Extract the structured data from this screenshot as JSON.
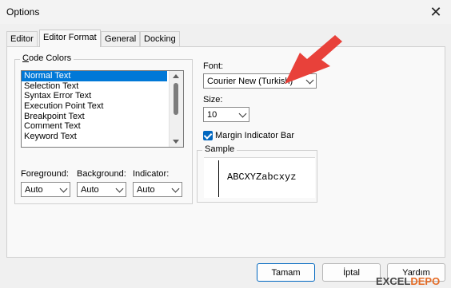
{
  "window": {
    "title": "Options",
    "close_glyph": "✕"
  },
  "tabs": [
    "Editor",
    "Editor Format",
    "General",
    "Docking"
  ],
  "active_tab": "Editor Format",
  "code_colors": {
    "label": "Code Colors",
    "items": [
      "Normal Text",
      "Selection Text",
      "Syntax Error Text",
      "Execution Point Text",
      "Breakpoint Text",
      "Comment Text",
      "Keyword Text"
    ],
    "selected": "Normal Text"
  },
  "color_selectors": [
    {
      "label": "Foreground:",
      "value": "Auto"
    },
    {
      "label": "Background:",
      "value": "Auto"
    },
    {
      "label": "Indicator:",
      "value": "Auto"
    }
  ],
  "font": {
    "label": "Font:",
    "value": "Courier New (Turkish)"
  },
  "size": {
    "label": "Size:",
    "value": "10"
  },
  "margin_indicator": {
    "label": "Margin Indicator Bar",
    "checked": true
  },
  "sample": {
    "label": "Sample",
    "text": "ABCXYZabcxyz"
  },
  "buttons": {
    "ok": "Tamam",
    "cancel": "İptal",
    "help": "Yardım"
  },
  "watermark": {
    "part1": "EXCEL",
    "part2": "DEPO"
  },
  "colors": {
    "selection": "#0078d7",
    "arrow": "#e8413a",
    "checkbox": "#0067c0"
  },
  "icons": {
    "close": "close-icon",
    "dropdown": "chevron-down-icon",
    "annotation": "red-arrow-icon"
  }
}
